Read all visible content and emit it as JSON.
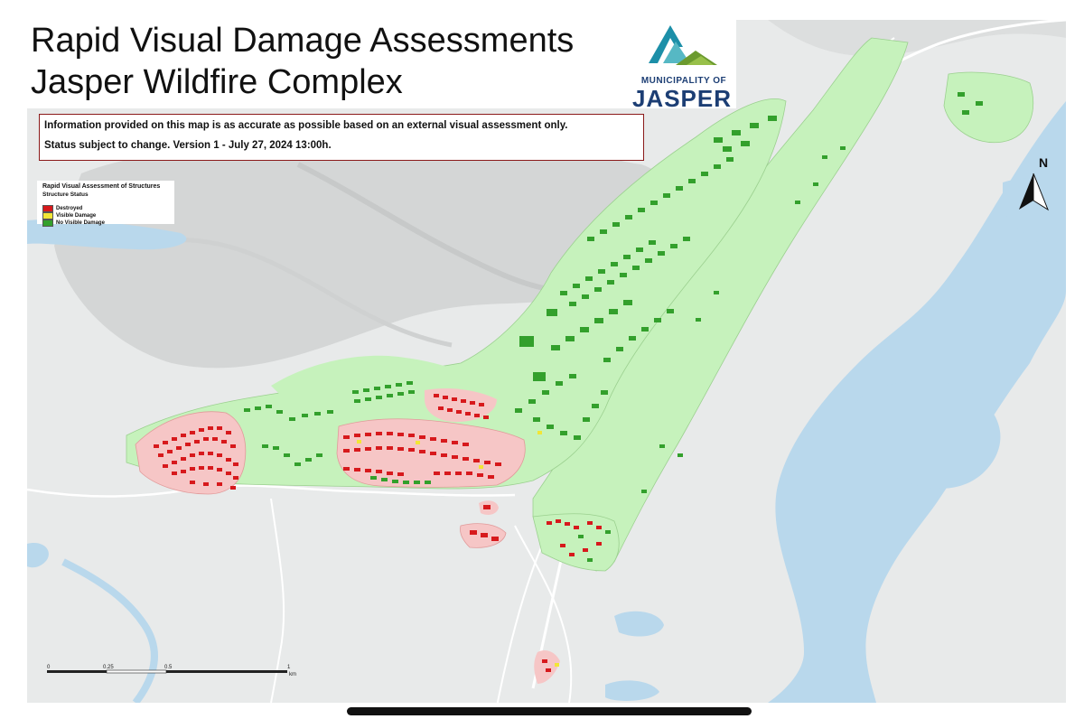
{
  "title": {
    "line1": "Rapid Visual Damage Assessments",
    "line2": "Jasper Wildfire Complex"
  },
  "logo": {
    "small_text": "MUNICIPALITY OF",
    "big_text": "JASPER"
  },
  "notice": {
    "line1": "Information provided on this map is as accurate as possible based on an external visual assessment only.",
    "line2": "Status subject to change. Version 1 - July 27, 2024 13:00h."
  },
  "legend": {
    "title": "Rapid Visual Assessment of Structures",
    "subtitle": "Structure Status",
    "items": [
      {
        "label": "Destroyed",
        "color": "#d7191c"
      },
      {
        "label": "Visible Damage",
        "color": "#f2e636"
      },
      {
        "label": "No Visible Damage",
        "color": "#33a02c"
      }
    ]
  },
  "scale": {
    "ticks": [
      "0",
      "0.25",
      "0.5",
      "1"
    ],
    "unit": "km"
  },
  "north_arrow": {
    "label": "N"
  },
  "colors": {
    "terrain": "#e6e8e8",
    "water": "#b9d8ec",
    "burn_zone": "#f6c6c6",
    "safe_zone": "#c6f2bc",
    "destroyed": "#d7191c",
    "no_damage": "#33a02c",
    "visible_damage": "#f2e636"
  },
  "ui": {
    "scroll_indicator": "scroll-bar"
  }
}
